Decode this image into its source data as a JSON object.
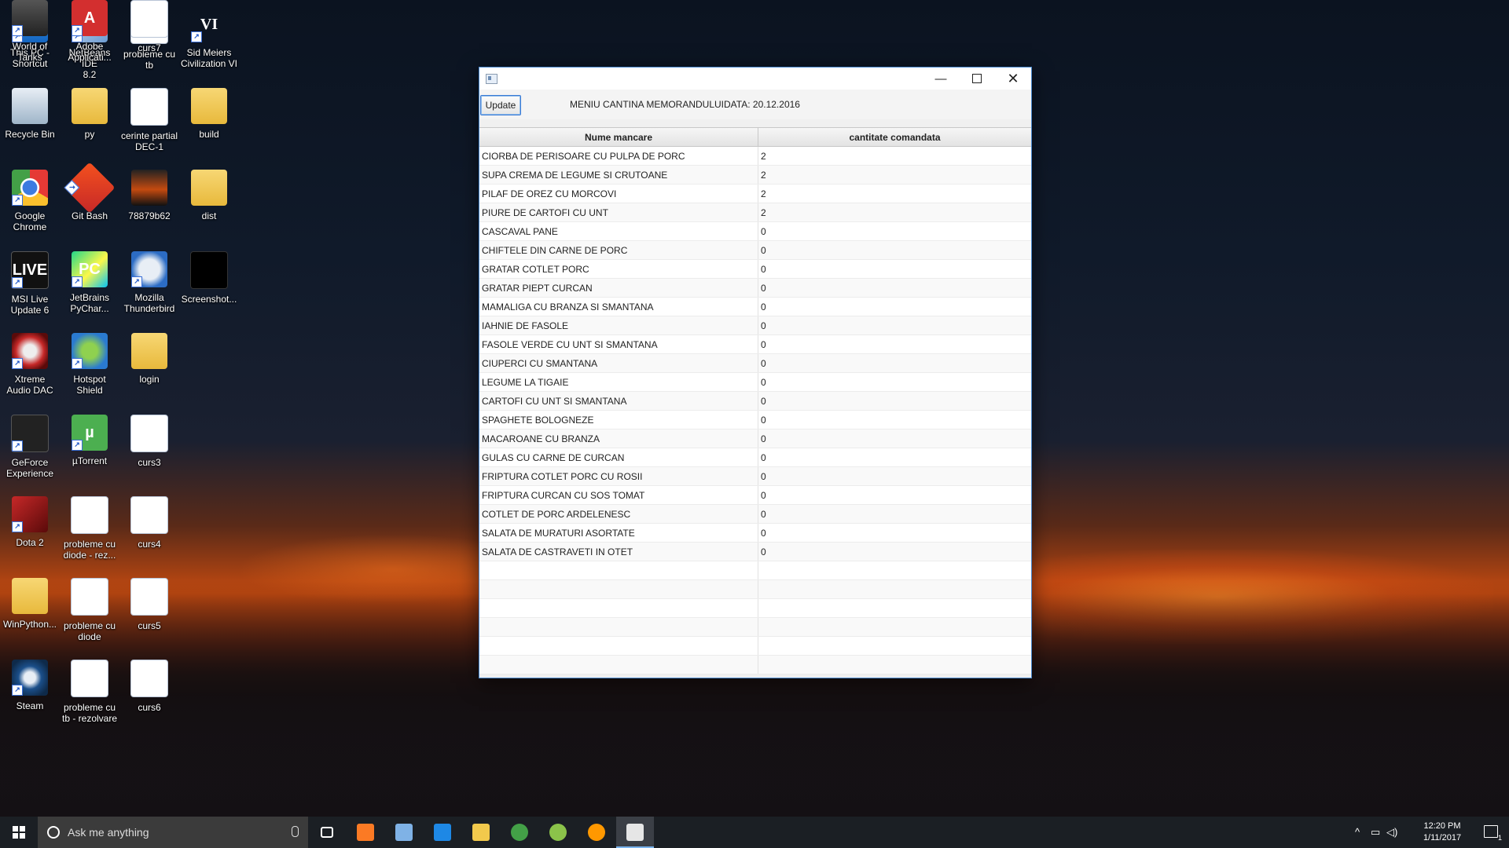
{
  "desktop": {
    "icons": [
      {
        "label": "This PC -\nShortcut",
        "icon": "computer-icon"
      },
      {
        "label": "NetBeans IDE\n8.2",
        "icon": "netbeans-icon"
      },
      {
        "label": "probleme cu\ntb",
        "icon": "pdf-icon"
      },
      {
        "label": "Sid Meiers\nCivilization VI",
        "icon": "civilization-icon"
      },
      {
        "label": "Recycle Bin",
        "icon": "recycle-bin-icon"
      },
      {
        "label": "py",
        "icon": "folder-icon"
      },
      {
        "label": "cerinte partial\nDEC-1",
        "icon": "pdf-icon"
      },
      {
        "label": "build",
        "icon": "folder-icon"
      },
      {
        "label": "Google\nChrome",
        "icon": "chrome-icon"
      },
      {
        "label": "Git Bash",
        "icon": "git-icon"
      },
      {
        "label": "78879b62",
        "icon": "image-icon"
      },
      {
        "label": "dist",
        "icon": "folder-icon"
      },
      {
        "label": "MSI Live\nUpdate 6",
        "icon": "msi-icon"
      },
      {
        "label": "JetBrains\nPyChar...",
        "icon": "pycharm-icon"
      },
      {
        "label": "Mozilla\nThunderbird",
        "icon": "thunderbird-icon"
      },
      {
        "label": "Screenshot...",
        "icon": "screenshot-icon"
      },
      {
        "label": "Xtreme\nAudio DAC",
        "icon": "audio-icon"
      },
      {
        "label": "Hotspot\nShield",
        "icon": "hotspot-icon"
      },
      {
        "label": "login",
        "icon": "folder-icon"
      },
      {
        "label": "GeForce\nExperience",
        "icon": "geforce-icon"
      },
      {
        "label": "µTorrent",
        "icon": "utorrent-icon"
      },
      {
        "label": "curs3",
        "icon": "pdf-icon"
      },
      {
        "label": "Dota 2",
        "icon": "dota-icon"
      },
      {
        "label": "probleme cu\ndiode - rez...",
        "icon": "pdf-icon"
      },
      {
        "label": "curs4",
        "icon": "pdf-icon"
      },
      {
        "label": "WinPython...",
        "icon": "folder-icon"
      },
      {
        "label": "probleme cu\ndiode",
        "icon": "pdf-icon"
      },
      {
        "label": "curs5",
        "icon": "pdf-icon"
      },
      {
        "label": "Steam",
        "icon": "steam-icon"
      },
      {
        "label": "probleme cu\ntb - rezolvare",
        "icon": "pdf-icon"
      },
      {
        "label": "curs6",
        "icon": "pdf-icon"
      },
      {
        "label": "World of\nTanks",
        "icon": "tanks-icon"
      },
      {
        "label": "Adobe\nApplicati...",
        "icon": "adobe-icon"
      },
      {
        "label": "curs7",
        "icon": "pdf-icon"
      }
    ],
    "pdf_glyph": "pdf",
    "civ_glyph": "VI",
    "pc_glyph": "PC",
    "live_glyph": "LIVE",
    "utorrent_glyph": "µ",
    "adobe_glyph": "A",
    "shortcut_glyph": "↗"
  },
  "window": {
    "update_label": "Update",
    "menu_title": "MENIU CANTINA MEMORANDULUIDATA: 20.12.2016",
    "columns": [
      "Nume mancare",
      "cantitate comandata"
    ],
    "rows": [
      [
        "CIORBA DE PERISOARE CU PULPA DE PORC",
        "2"
      ],
      [
        "SUPA CREMA DE LEGUME SI CRUTOANE",
        "2"
      ],
      [
        "PILAF DE OREZ CU MORCOVI",
        "2"
      ],
      [
        "PIURE DE CARTOFI CU UNT",
        "2"
      ],
      [
        "CASCAVAL PANE",
        "0"
      ],
      [
        "CHIFTELE DIN CARNE DE PORC",
        "0"
      ],
      [
        "GRATAR COTLET PORC",
        "0"
      ],
      [
        "GRATAR PIEPT CURCAN",
        "0"
      ],
      [
        "MAMALIGA CU BRANZA SI SMANTANA",
        "0"
      ],
      [
        "IAHNIE DE FASOLE",
        "0"
      ],
      [
        "FASOLE VERDE CU UNT SI SMANTANA",
        "0"
      ],
      [
        "CIUPERCI CU SMANTANA",
        "0"
      ],
      [
        "LEGUME LA TIGAIE",
        "0"
      ],
      [
        "CARTOFI CU UNT SI SMANTANA",
        "0"
      ],
      [
        "SPAGHETE BOLOGNEZE",
        "0"
      ],
      [
        "MACAROANE CU BRANZA",
        "0"
      ],
      [
        "GULAS CU CARNE DE CURCAN",
        "0"
      ],
      [
        "FRIPTURA COTLET PORC CU ROSII",
        "0"
      ],
      [
        "FRIPTURA CURCAN CU SOS TOMAT",
        "0"
      ],
      [
        "COTLET DE PORC ARDELENESC",
        "0"
      ],
      [
        "SALATA DE MURATURI ASORTATE",
        "0"
      ],
      [
        "SALATA DE CASTRAVETI IN OTET",
        "0"
      ]
    ],
    "empty_rows": 6,
    "minimize_glyph": "—",
    "close_glyph": "✕"
  },
  "taskbar": {
    "search_placeholder": "Ask me anything",
    "apps": [
      {
        "name": "task-view",
        "color": "#1b1f24"
      },
      {
        "name": "xampp",
        "color": "#fb7a24"
      },
      {
        "name": "netbeans",
        "color": "#7fb2e6"
      },
      {
        "name": "edge",
        "color": "#1e88e5"
      },
      {
        "name": "file-explorer",
        "color": "#f2c94c"
      },
      {
        "name": "chrome",
        "color": "#43a047"
      },
      {
        "name": "android-studio",
        "color": "#8bc34a"
      },
      {
        "name": "firefox",
        "color": "#ff9800"
      },
      {
        "name": "java-app",
        "color": "#e6e6e6"
      }
    ],
    "time": "12:20 PM",
    "date": "1/11/2017",
    "notification_count": "1",
    "tray_chevron": "^",
    "colors": {
      "taskbar": "#1b1f24",
      "accent": "#7ab4ee"
    }
  }
}
